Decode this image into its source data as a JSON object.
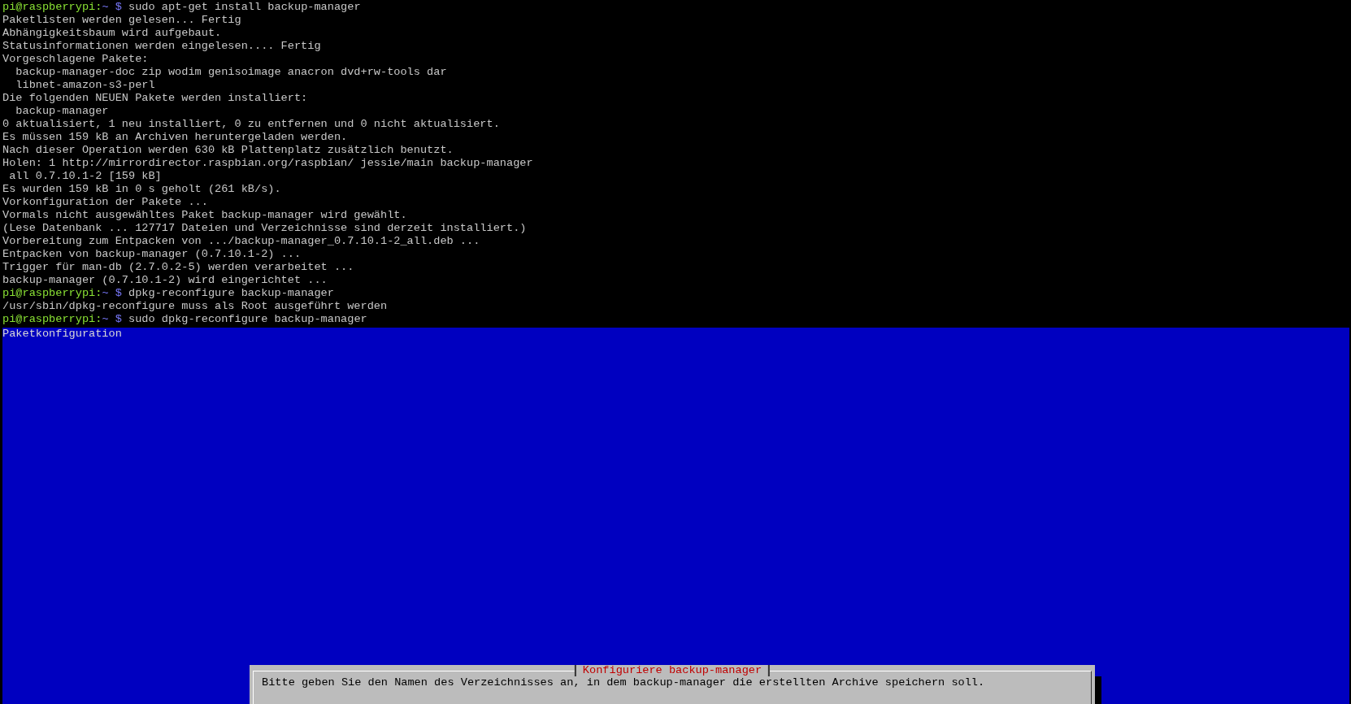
{
  "terminal": {
    "lines": [
      {
        "kind": "prompt",
        "host": "pi@raspberrypi:",
        "cwd": "~ $",
        "command": "sudo apt-get install backup-manager"
      },
      {
        "kind": "output",
        "text": "Paketlisten werden gelesen... Fertig"
      },
      {
        "kind": "output",
        "text": "Abhängigkeitsbaum wird aufgebaut."
      },
      {
        "kind": "output",
        "text": "Statusinformationen werden eingelesen.... Fertig"
      },
      {
        "kind": "output",
        "text": "Vorgeschlagene Pakete:"
      },
      {
        "kind": "output",
        "text": "  backup-manager-doc zip wodim genisoimage anacron dvd+rw-tools dar"
      },
      {
        "kind": "output",
        "text": "  libnet-amazon-s3-perl"
      },
      {
        "kind": "output",
        "text": "Die folgenden NEUEN Pakete werden installiert:"
      },
      {
        "kind": "output",
        "text": "  backup-manager"
      },
      {
        "kind": "output",
        "text": "0 aktualisiert, 1 neu installiert, 0 zu entfernen und 0 nicht aktualisiert."
      },
      {
        "kind": "output",
        "text": "Es müssen 159 kB an Archiven heruntergeladen werden."
      },
      {
        "kind": "output",
        "text": "Nach dieser Operation werden 630 kB Plattenplatz zusätzlich benutzt."
      },
      {
        "kind": "output",
        "text": "Holen: 1 http://mirrordirector.raspbian.org/raspbian/ jessie/main backup-manager"
      },
      {
        "kind": "output",
        "text": " all 0.7.10.1-2 [159 kB]"
      },
      {
        "kind": "output",
        "text": "Es wurden 159 kB in 0 s geholt (261 kB/s)."
      },
      {
        "kind": "output",
        "text": "Vorkonfiguration der Pakete ..."
      },
      {
        "kind": "output",
        "text": "Vormals nicht ausgewähltes Paket backup-manager wird gewählt."
      },
      {
        "kind": "output",
        "text": "(Lese Datenbank ... 127717 Dateien und Verzeichnisse sind derzeit installiert.)"
      },
      {
        "kind": "output",
        "text": "Vorbereitung zum Entpacken von .../backup-manager_0.7.10.1-2_all.deb ..."
      },
      {
        "kind": "output",
        "text": "Entpacken von backup-manager (0.7.10.1-2) ..."
      },
      {
        "kind": "output",
        "text": "Trigger für man-db (2.7.0.2-5) werden verarbeitet ..."
      },
      {
        "kind": "output",
        "text": "backup-manager (0.7.10.1-2) wird eingerichtet ..."
      },
      {
        "kind": "prompt",
        "host": "pi@raspberrypi:",
        "cwd": "~ $",
        "command": "dpkg-reconfigure backup-manager"
      },
      {
        "kind": "output",
        "text": "/usr/sbin/dpkg-reconfigure muss als Root ausgeführt werden"
      },
      {
        "kind": "prompt",
        "host": "pi@raspberrypi:",
        "cwd": "~ $",
        "command": "sudo dpkg-reconfigure backup-manager"
      }
    ]
  },
  "config_screen": {
    "title": "Paketkonfiguration",
    "dialog": {
      "title": "Konfiguriere backup-manager",
      "message": "Bitte geben Sie den Namen des Verzeichnisses an, in dem backup-manager die erstellten Archive speichern soll."
    }
  }
}
